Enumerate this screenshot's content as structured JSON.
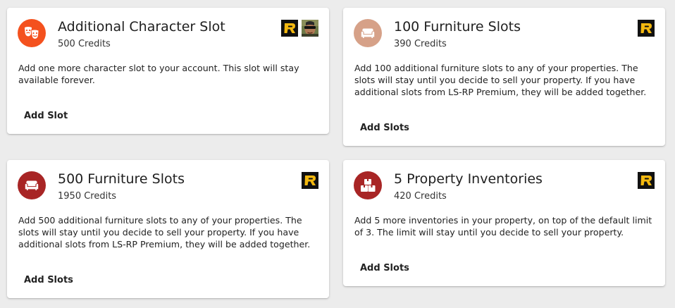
{
  "cards": [
    {
      "title": "Additional Character Slot",
      "credits": "500 Credits",
      "description": "Add one more character slot to your account. This slot will stay available forever.",
      "action_label": "Add Slot",
      "avatar_color": "#f4511e",
      "icon": "theater-masks-icon",
      "badges": [
        "r-logo-badge",
        "character-photo-badge"
      ]
    },
    {
      "title": "100 Furniture Slots",
      "credits": "390 Credits",
      "description": "Add 100 additional furniture slots to any of your properties. The slots will stay until you decide to sell your property. If you have additional slots from LS-RP Premium, they will be added together.",
      "action_label": "Add Slots",
      "avatar_color": "#d6a188",
      "icon": "sofa-icon",
      "badges": [
        "r-logo-badge"
      ]
    },
    {
      "title": "500 Furniture Slots",
      "credits": "1950 Credits",
      "description": "Add 500 additional furniture slots to any of your properties. The slots will stay until you decide to sell your property. If you have additional slots from LS-RP Premium, they will be added together.",
      "action_label": "Add Slots",
      "avatar_color": "#a82525",
      "icon": "sofa-icon",
      "badges": [
        "r-logo-badge"
      ]
    },
    {
      "title": "5 Property Inventories",
      "credits": "420 Credits",
      "description": "Add 5 more inventories in your property, on top of the default limit of 3. The limit will stay until you decide to sell your property.",
      "action_label": "Add Slots",
      "avatar_color": "#a82525",
      "icon": "boxes-icon",
      "badges": [
        "r-logo-badge"
      ]
    }
  ],
  "colors": {
    "background": "#ececec",
    "card": "#ffffff",
    "badge_yellow": "#f3b80f",
    "badge_black": "#111111"
  }
}
